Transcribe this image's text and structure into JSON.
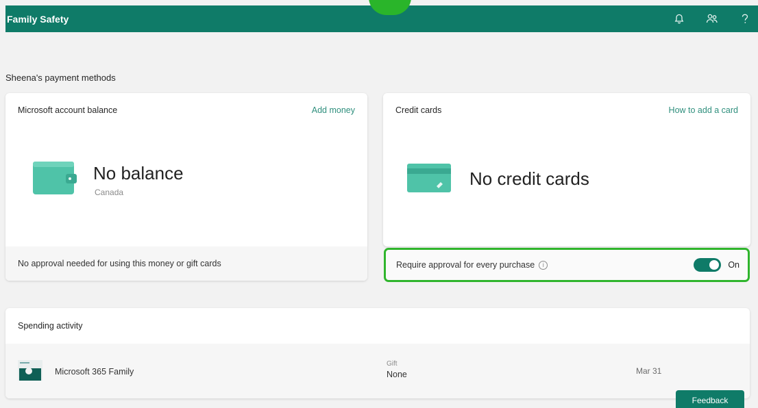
{
  "header": {
    "app_title": "Family Safety",
    "icons": [
      "bell-icon",
      "people-icon",
      "help-icon"
    ]
  },
  "section_title": "Sheena's payment methods",
  "balance_card": {
    "title": "Microsoft account balance",
    "link": "Add money",
    "big_text": "No balance",
    "region": "Canada",
    "footer": "No approval needed for using this money or gift cards"
  },
  "credit_card": {
    "title": "Credit cards",
    "link": "How to add a card",
    "big_text": "No credit cards",
    "approval_label": "Require approval for every purchase",
    "toggle_state": "On"
  },
  "spending": {
    "title": "Spending activity",
    "rows": [
      {
        "name": "Microsoft 365 Family",
        "type": "Gift",
        "value": "None",
        "date": "Mar 31"
      }
    ]
  },
  "feedback_label": "Feedback",
  "colors": {
    "brand": "#0f7b68",
    "highlight": "#2fb52c",
    "link": "#2f8f7d",
    "icon_teal": "#4fc3a8"
  }
}
